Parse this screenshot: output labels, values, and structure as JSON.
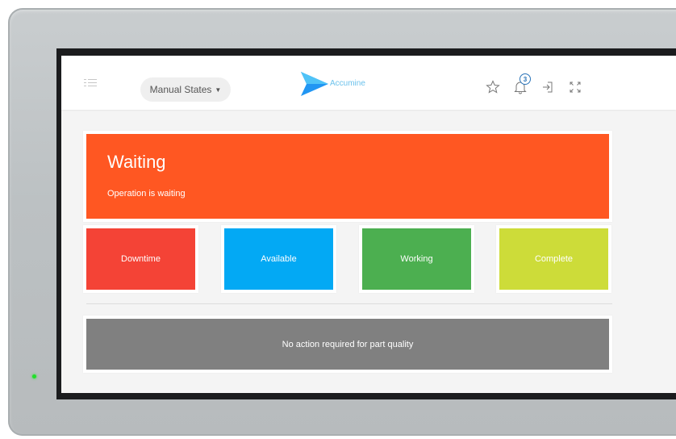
{
  "header": {
    "states_dropdown": "Manual States",
    "brand": "Accumine",
    "notification_count": "3"
  },
  "status": {
    "title": "Waiting",
    "description": "Operation is waiting",
    "color": "#ff5722"
  },
  "state_buttons": [
    {
      "label": "Downtime",
      "color": "#f44336"
    },
    {
      "label": "Available",
      "color": "#03a9f4"
    },
    {
      "label": "Working",
      "color": "#4caf50"
    },
    {
      "label": "Complete",
      "color": "#cddc39"
    }
  ],
  "quality": {
    "message": "No action required for part quality",
    "color": "#808080"
  },
  "icons": {
    "menu": "menu-icon",
    "logo": "play-logo-icon",
    "favorite": "star-icon",
    "notifications": "bell-icon",
    "logout": "sign-out-icon",
    "fullscreen": "fullscreen-icon"
  }
}
